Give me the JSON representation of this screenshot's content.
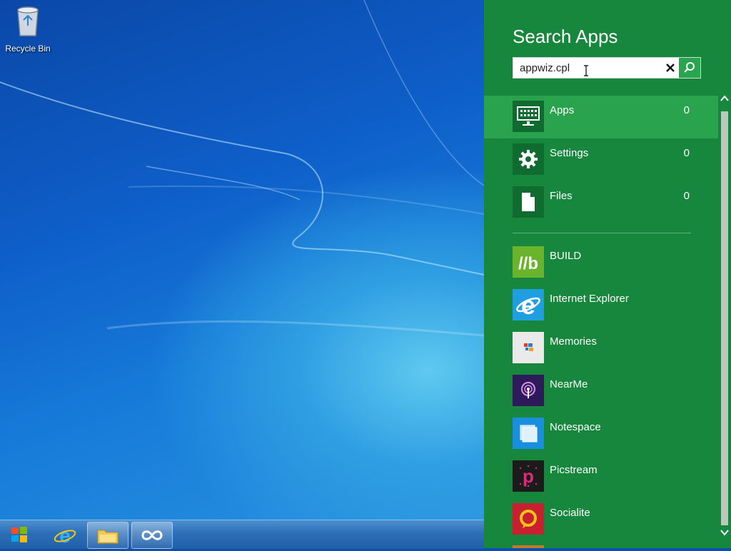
{
  "desktop": {
    "icons": [
      {
        "label": "Recycle Bin",
        "icon": "recycle-bin-icon"
      }
    ]
  },
  "taskbar": {
    "start_icon": "windows-logo-icon",
    "apps": [
      {
        "name": "Internet Explorer",
        "icon": "internet-explorer-icon"
      },
      {
        "name": "File Explorer",
        "icon": "folder-icon"
      },
      {
        "name": "Infinity app",
        "icon": "infinity-icon"
      }
    ]
  },
  "search": {
    "title": "Search Apps",
    "query": "appwiz.cpl",
    "clear_icon": "close-icon",
    "go_icon": "search-icon",
    "scopes": [
      {
        "label": "Apps",
        "count": "0",
        "icon": "keyboard-icon",
        "selected": true
      },
      {
        "label": "Settings",
        "count": "0",
        "icon": "gear-icon",
        "selected": false
      },
      {
        "label": "Files",
        "count": "0",
        "icon": "file-icon",
        "selected": false
      }
    ],
    "apps": [
      {
        "label": "BUILD",
        "icon": "build-icon",
        "color": "#6ab42d"
      },
      {
        "label": "Internet Explorer",
        "icon": "internet-explorer-icon",
        "color": "#1f9ee0"
      },
      {
        "label": "Memories",
        "icon": "memories-icon",
        "color": "#eaeaea"
      },
      {
        "label": "NearMe",
        "icon": "nearme-icon",
        "color": "#2e1a5a"
      },
      {
        "label": "Notespace",
        "icon": "notespace-icon",
        "color": "#1a8fe0"
      },
      {
        "label": "Picstream",
        "icon": "picstream-icon",
        "color": "#1b1b1b"
      },
      {
        "label": "Socialite",
        "icon": "socialite-icon",
        "color": "#c8202e"
      }
    ]
  },
  "colors": {
    "charm_background": "#16873d",
    "selected_row": "#2aa34e",
    "desktop_blue": "#0e5ec8"
  }
}
